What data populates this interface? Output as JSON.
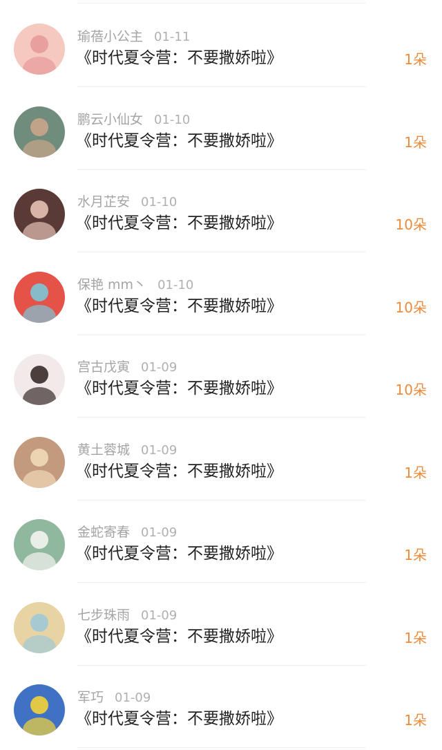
{
  "gifts": [
    {
      "user": "瑜蓓小公主",
      "date": "01-11",
      "title": "《时代夏令营：不要撒娇啦》",
      "amount": "1朵",
      "avatar_color": "#f5c9c0",
      "avatar_accent": "#e89a98"
    },
    {
      "user": "鹏云小仙女",
      "date": "01-10",
      "title": "《时代夏令营：不要撒娇啦》",
      "amount": "1朵",
      "avatar_color": "#6f8c7c",
      "avatar_accent": "#c9a58a"
    },
    {
      "user": "水月芷安",
      "date": "01-10",
      "title": "《时代夏令营：不要撒娇啦》",
      "amount": "10朵",
      "avatar_color": "#5a3a36",
      "avatar_accent": "#e4c1b5"
    },
    {
      "user": "保艳 mm丶",
      "date": "01-10",
      "title": "《时代夏令营：不要撒娇啦》",
      "amount": "10朵",
      "avatar_color": "#e55248",
      "avatar_accent": "#7cc7d8"
    },
    {
      "user": "宫古戊寅",
      "date": "01-09",
      "title": "《时代夏令营：不要撒娇啦》",
      "amount": "10朵",
      "avatar_color": "#f2eaea",
      "avatar_accent": "#3b2b2b"
    },
    {
      "user": "黄土蓉城",
      "date": "01-09",
      "title": "《时代夏令营：不要撒娇啦》",
      "amount": "1朵",
      "avatar_color": "#c39a7e",
      "avatar_accent": "#f1d9b8"
    },
    {
      "user": "金蛇寄春",
      "date": "01-09",
      "title": "《时代夏令营：不要撒娇啦》",
      "amount": "1朵",
      "avatar_color": "#8fb89e",
      "avatar_accent": "#f4f4f0"
    },
    {
      "user": "七步珠雨",
      "date": "01-09",
      "title": "《时代夏令营：不要撒娇啦》",
      "amount": "1朵",
      "avatar_color": "#e7d3a3",
      "avatar_accent": "#9fc9d6"
    },
    {
      "user": "军巧",
      "date": "01-09",
      "title": "《时代夏令营：不要撒娇啦》",
      "amount": "1朵",
      "avatar_color": "#3f72c2",
      "avatar_accent": "#f3d33a"
    }
  ]
}
